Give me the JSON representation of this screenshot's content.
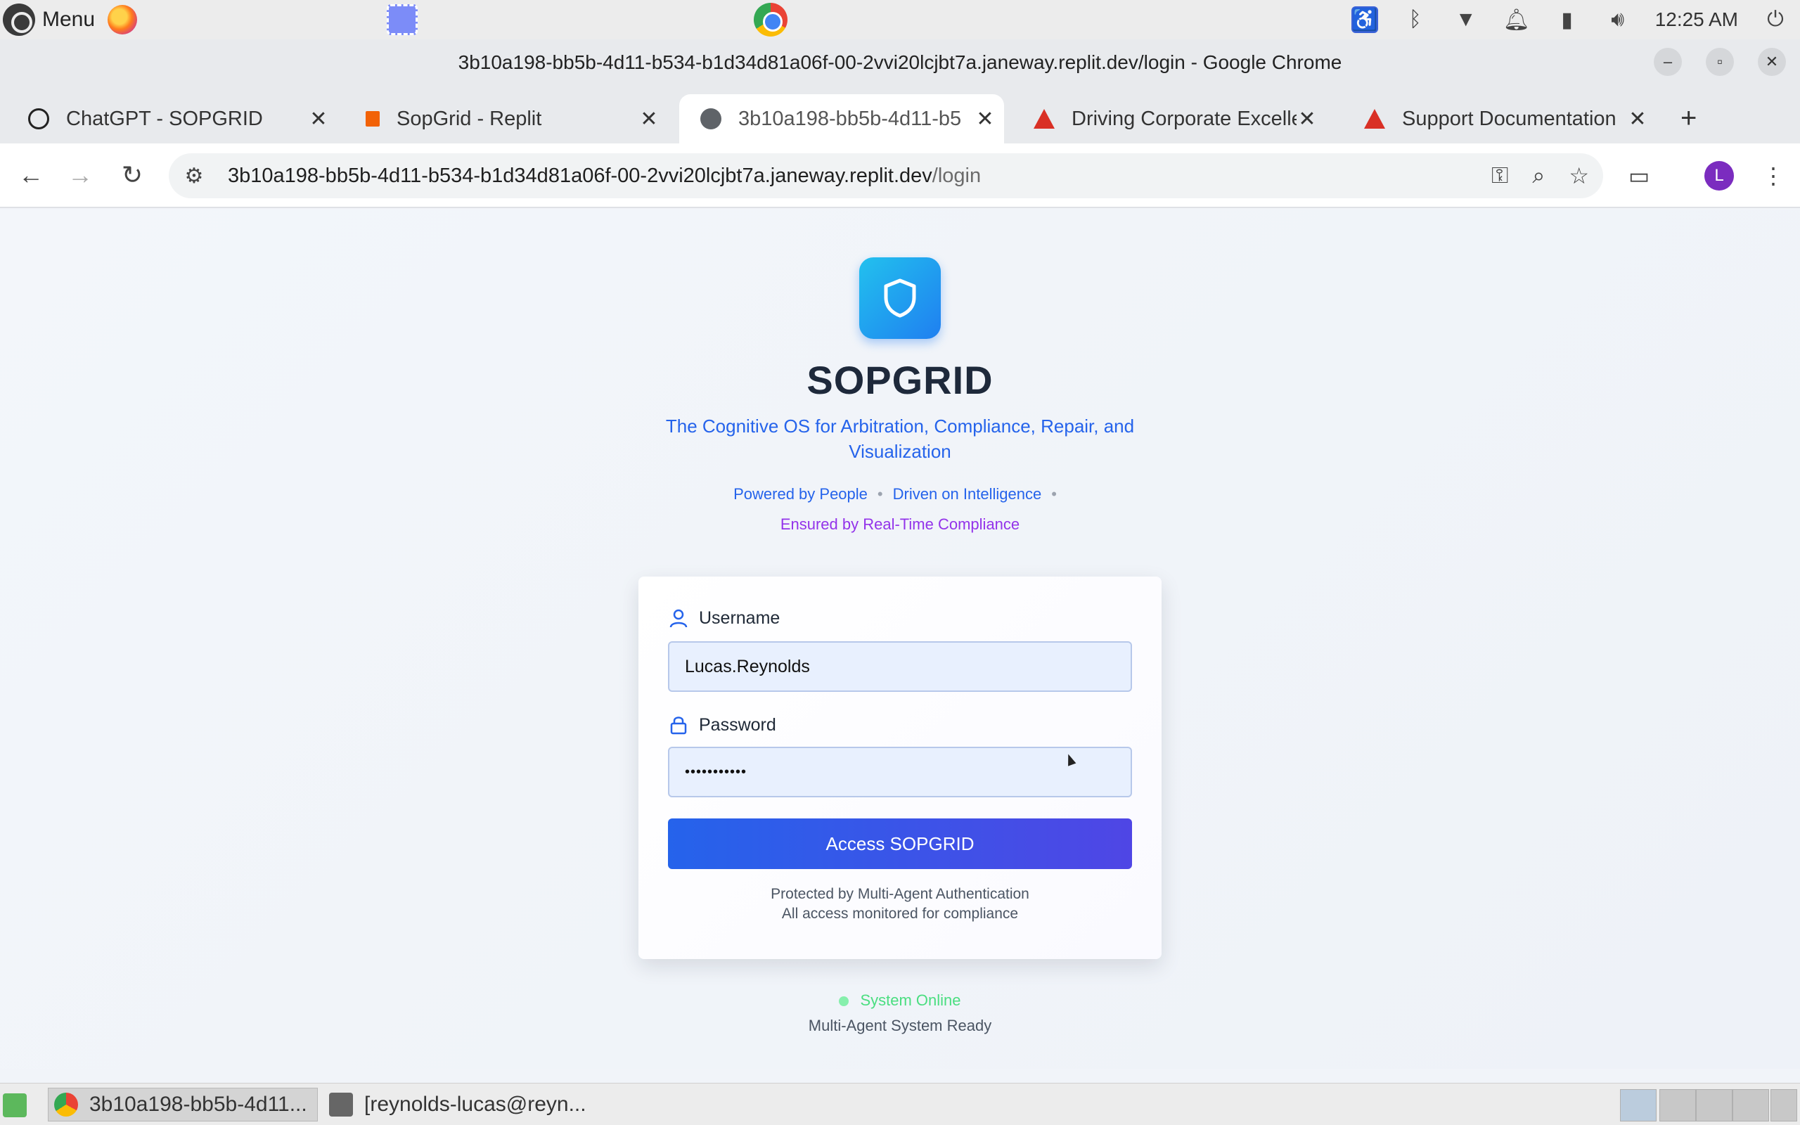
{
  "os": {
    "menu_label": "Menu",
    "clock": "12:25 AM"
  },
  "window": {
    "title": "3b10a198-bb5b-4d11-b534-b1d34d81a06f-00-2vvi20lcjbt7a.janeway.replit.dev/login - Google Chrome"
  },
  "tabs": [
    {
      "label": "ChatGPT - SOPGRID",
      "icon": "openai-icon"
    },
    {
      "label": "SopGrid - Replit",
      "icon": "replit-icon"
    },
    {
      "label": "3b10a198-bb5b-4d11-b5",
      "icon": "globe-icon"
    },
    {
      "label": "Driving Corporate Excelle",
      "icon": "red-triangle-icon"
    },
    {
      "label": "Support Documentation",
      "icon": "red-triangle-icon"
    }
  ],
  "address_bar": {
    "host": "3b10a198-bb5b-4d11-b534-b1d34d81a06f-00-2vvi20lcjbt7a.janeway.replit.dev",
    "path": "/login"
  },
  "profile_initial": "L",
  "login": {
    "brand": "SOPGRID",
    "tagline": "The Cognitive OS for Arbitration, Compliance, Repair, and Visualization",
    "motto1": "Powered by People",
    "motto2": "Driven on Intelligence",
    "motto3": "Ensured by Real-Time Compliance",
    "username_label": "Username",
    "username_value": "Lucas.Reynolds",
    "password_label": "Password",
    "password_value": "•••••••••••",
    "submit_label": "Access SOPGRID",
    "note1": "Protected by Multi-Agent Authentication",
    "note2": "All access monitored for compliance",
    "status": "System Online",
    "status_sub": "Multi-Agent System Ready"
  },
  "taskbar": {
    "items": [
      {
        "label": "3b10a198-bb5b-4d11..."
      },
      {
        "label": "[reynolds-lucas@reyn..."
      }
    ]
  },
  "colors": {
    "accent": "#2563eb",
    "accent2": "#4f46e5",
    "purple": "#9333ea",
    "online": "#4ade80"
  }
}
